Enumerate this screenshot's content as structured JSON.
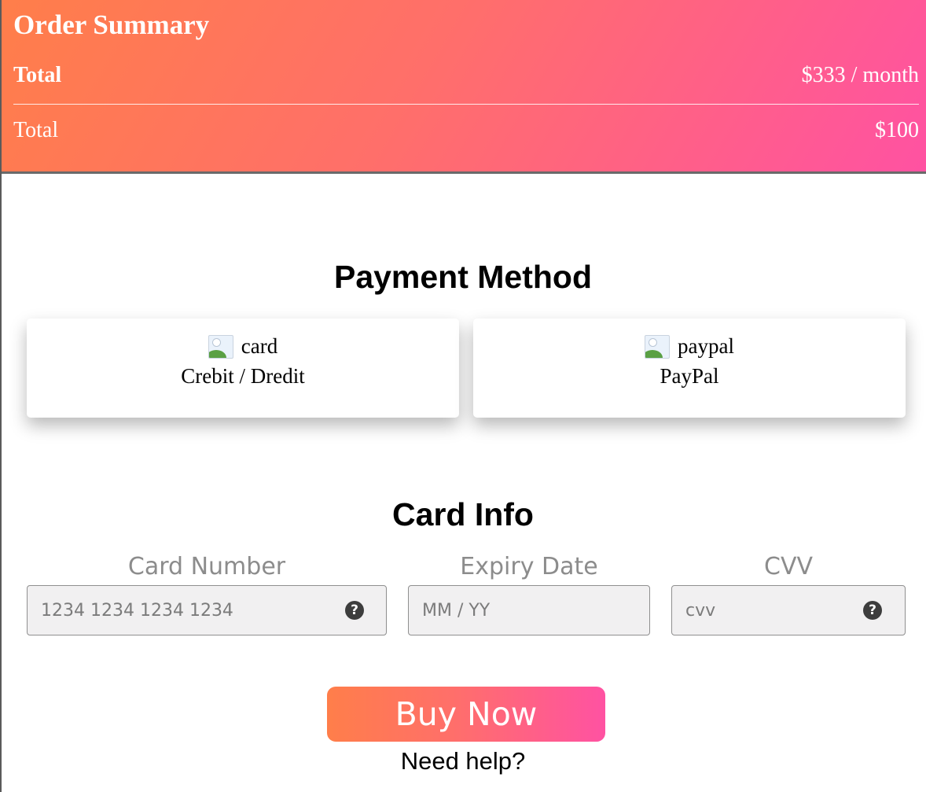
{
  "summary": {
    "title": "Order Summary",
    "rows": [
      {
        "label": "Total",
        "value": "$333 / month"
      },
      {
        "label": "Total",
        "value": "$100"
      }
    ]
  },
  "payment": {
    "title": "Payment Method",
    "methods": [
      {
        "alt": "card",
        "label": "Crebit / Dredit"
      },
      {
        "alt": "paypal",
        "label": "PayPal"
      }
    ]
  },
  "card_info": {
    "title": "Card Info",
    "fields": [
      {
        "label": "Card Number",
        "placeholder": "1234 1234 1234 1234",
        "value": ""
      },
      {
        "label": "Expiry Date",
        "placeholder": "MM / YY",
        "value": ""
      },
      {
        "label": "CVV",
        "placeholder": "cvv",
        "value": ""
      }
    ]
  },
  "actions": {
    "buy_label": "Buy Now",
    "help_text": "Need help?"
  },
  "icons": {
    "help": "question-circle-icon",
    "image_placeholder": "broken-image-icon"
  },
  "colors": {
    "gradient_start": "#ff7e4a",
    "gradient_end": "#ff52a2"
  }
}
